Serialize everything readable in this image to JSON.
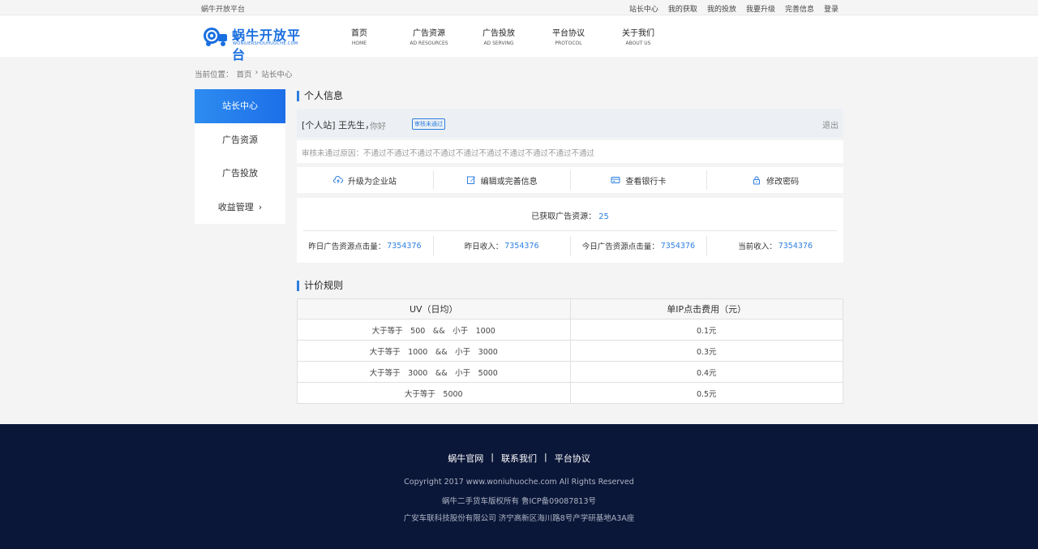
{
  "topbar": {
    "brand": "蜗牛开放平台",
    "links": [
      "站长中心",
      "我的获取",
      "我的投放",
      "我要升级",
      "完善信息",
      "登录"
    ]
  },
  "logo": {
    "text": "蜗牛开放平台",
    "sub": "WONIUERSHOUHUOCHE.COM",
    "icon": "snail-truck-logo-icon"
  },
  "nav": [
    {
      "zh": "首页",
      "en": "HOME"
    },
    {
      "zh": "广告资源",
      "en": "AD RESOURCES"
    },
    {
      "zh": "广告投放",
      "en": "AD SERVING"
    },
    {
      "zh": "平台协议",
      "en": "PROTOCOL"
    },
    {
      "zh": "关于我们",
      "en": "ABOUT US"
    }
  ],
  "breadcrumb": {
    "label": "当前位置：",
    "home": "首页",
    "sep": "›",
    "current": "站长中心"
  },
  "sidebar": [
    "站长中心",
    "广告资源",
    "广告投放",
    "收益管理"
  ],
  "personal": {
    "title": "个人信息",
    "who": "[个人站] 王先生，",
    "greet": "你好",
    "badge": "审核未通过",
    "logout": "退出",
    "reason": "审核未通过原因：不通过不通过不通过不通过不通过不通过不通过不通过不通过不通过"
  },
  "actions": [
    {
      "label": "升级为企业站",
      "icon": "cloud-upload-icon"
    },
    {
      "label": "编辑或完善信息",
      "icon": "edit-icon"
    },
    {
      "label": "查看银行卡",
      "icon": "bank-card-icon"
    },
    {
      "label": "修改密码",
      "icon": "lock-icon"
    }
  ],
  "stats": {
    "total_label": "已获取广告资源：",
    "total_value": "25",
    "items": [
      {
        "label": "昨日广告资源点击量：",
        "value": "7354376"
      },
      {
        "label": "昨日收入：",
        "value": "7354376"
      },
      {
        "label": "今日广告资源点击量：",
        "value": "7354376"
      },
      {
        "label": "当前收入：",
        "value": "7354376"
      }
    ]
  },
  "pricing": {
    "title": "计价规则",
    "headers": [
      "UV（日均）",
      "单IP点击费用（元）"
    ],
    "rows": [
      [
        "大于等于　500　&&　小于　1000",
        "0.1元"
      ],
      [
        "大于等于　1000　&&　小于　3000",
        "0.3元"
      ],
      [
        "大于等于　3000　&&　小于　5000",
        "0.4元"
      ],
      [
        "大于等于　5000",
        "0.5元"
      ]
    ]
  },
  "footer": {
    "links": [
      "蜗牛官网",
      "联系我们",
      "平台协议"
    ],
    "copyright": "Copyright 2017 www.woniuhuoche.com All Rights Reserved",
    "icp": "蜗牛二手货车版权所有 鲁ICP备09087813号",
    "company": "广安车联科技股份有限公司 济宁高新区海川路8号产学研基地A3A座"
  },
  "colors": {
    "accent": "#2d7fe0",
    "footer_bg": "#0b1739"
  }
}
